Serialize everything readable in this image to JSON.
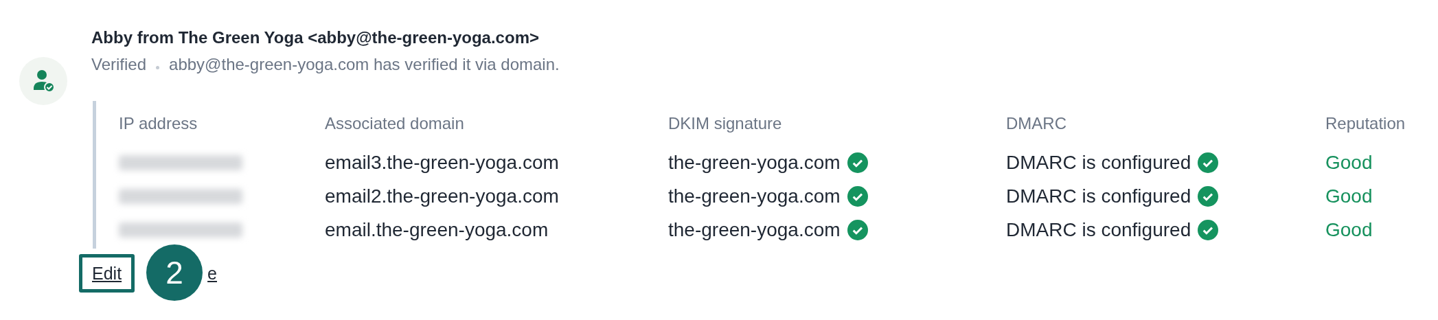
{
  "sender": {
    "title": "Abby from The Green Yoga <abby@the-green-yoga.com>",
    "status": "Verified",
    "detail": "abby@the-green-yoga.com has verified it via domain."
  },
  "table": {
    "columns": [
      "IP address",
      "Associated domain",
      "DKIM signature",
      "DMARC",
      "Reputation"
    ],
    "rows": [
      {
        "ip_redacted": true,
        "domain": "email3.the-green-yoga.com",
        "dkim": "the-green-yoga.com",
        "dkim_ok": true,
        "dmarc": "DMARC is configured",
        "dmarc_ok": true,
        "reputation": "Good"
      },
      {
        "ip_redacted": true,
        "domain": "email2.the-green-yoga.com",
        "dkim": "the-green-yoga.com",
        "dkim_ok": true,
        "dmarc": "DMARC is configured",
        "dmarc_ok": true,
        "reputation": "Good"
      },
      {
        "ip_redacted": true,
        "domain": "email.the-green-yoga.com",
        "dkim": "the-green-yoga.com",
        "dkim_ok": true,
        "dmarc": "DMARC is configured",
        "dmarc_ok": true,
        "reputation": "Good"
      }
    ]
  },
  "actions": [
    {
      "label": "Edit",
      "highlighted": true
    },
    {
      "label": "e",
      "highlighted": false
    }
  ],
  "step_badge": "2"
}
